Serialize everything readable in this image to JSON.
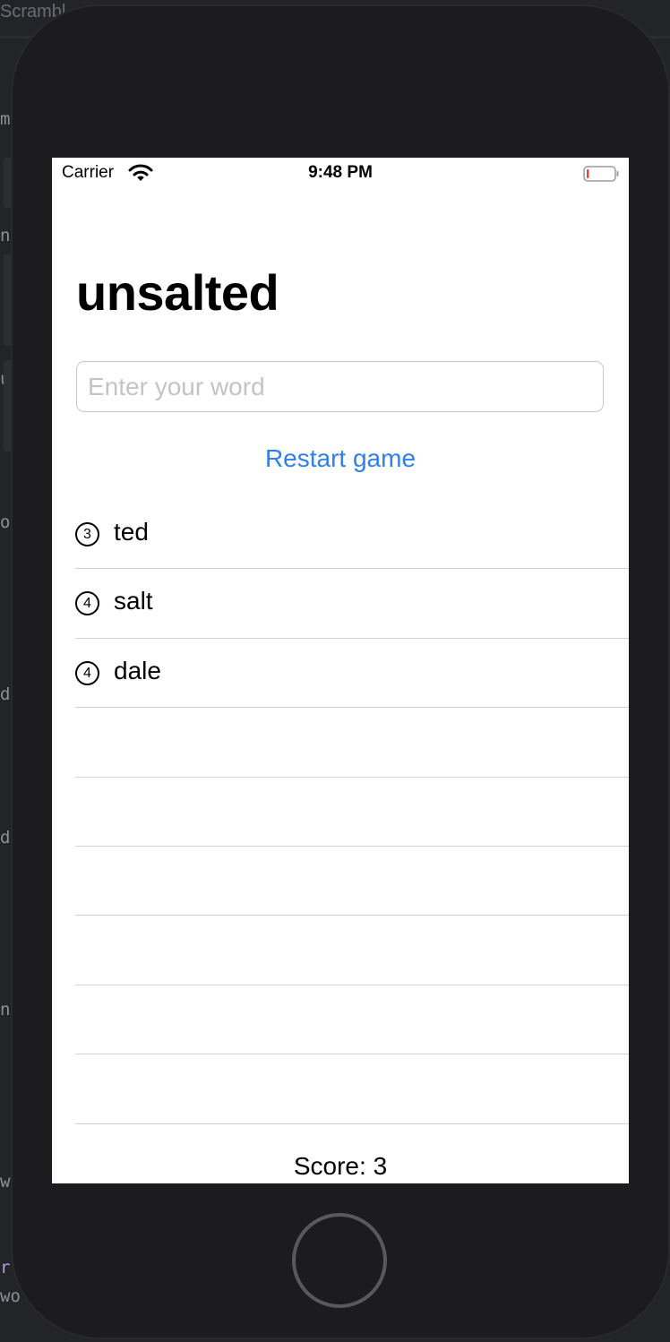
{
  "desktop": {
    "window_title": "Scrambl",
    "side_glyphs": [
      "m",
      ".",
      "n",
      "u",
      "o:",
      "d",
      "d",
      "n",
      "w",
      "r:",
      "wo"
    ]
  },
  "status_bar": {
    "carrier": "Carrier",
    "time": "9:48 PM",
    "battery_color": "#e5453a"
  },
  "game": {
    "root_word": "unsalted",
    "input": {
      "value": "",
      "placeholder": "Enter your word"
    },
    "restart_label": "Restart game",
    "used_words": [
      {
        "count": "3",
        "word": "ted"
      },
      {
        "count": "4",
        "word": "salt"
      },
      {
        "count": "4",
        "word": "dale"
      },
      {
        "count": "",
        "word": ""
      },
      {
        "count": "",
        "word": ""
      },
      {
        "count": "",
        "word": ""
      },
      {
        "count": "",
        "word": ""
      },
      {
        "count": "",
        "word": ""
      },
      {
        "count": "",
        "word": ""
      }
    ],
    "score_text": "Score: 3"
  },
  "colors": {
    "accent": "#2f80ed",
    "separator": "#d1d1d6",
    "placeholder": "#c4c4c7"
  }
}
